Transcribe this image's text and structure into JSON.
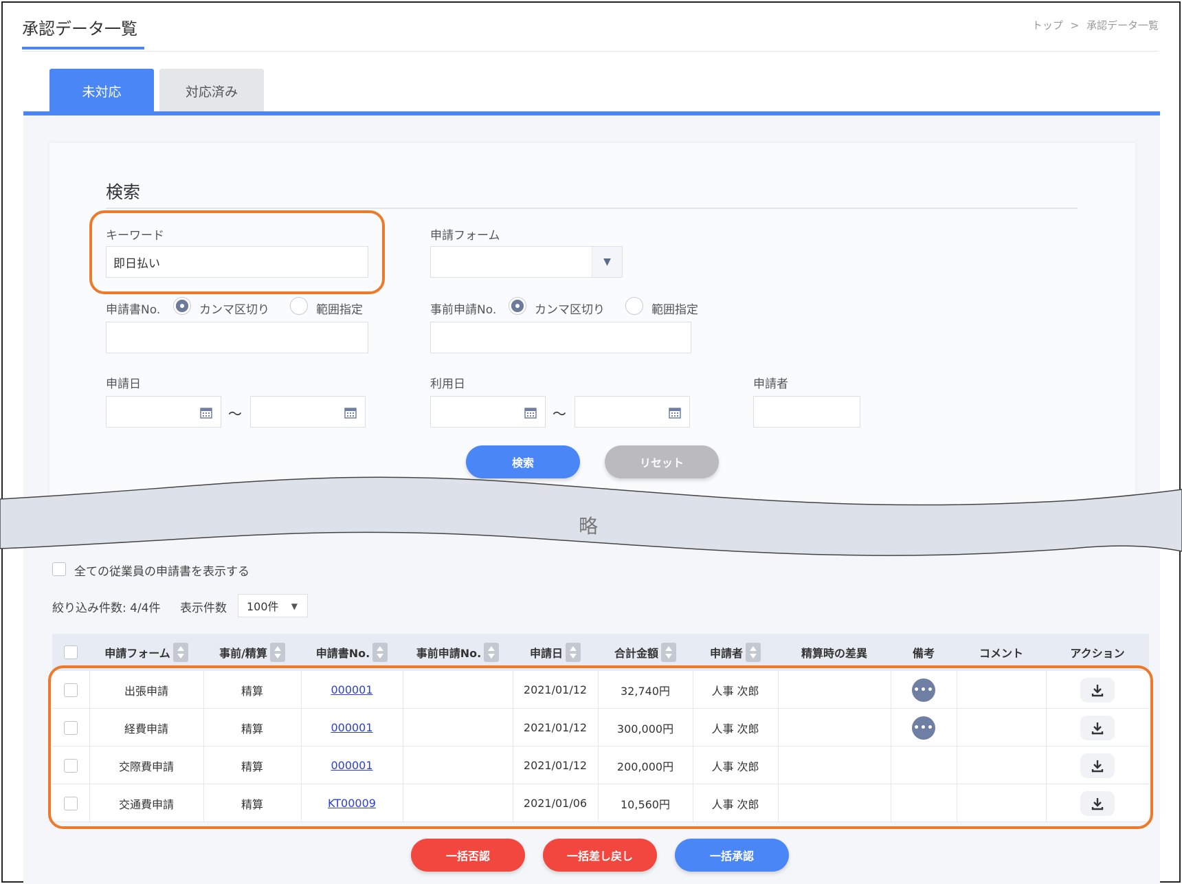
{
  "header": {
    "title": "承認データ一覧",
    "breadcrumb": [
      "トップ",
      ">",
      "承認データ一覧"
    ]
  },
  "tabs": [
    {
      "label": "未対応",
      "active": true
    },
    {
      "label": "対応済み",
      "active": false
    }
  ],
  "search": {
    "title": "検索",
    "keyword_label": "キーワード",
    "keyword_value": "即日払い",
    "form_label": "申請フォーム",
    "form_value": "",
    "app_no_label": "申請書No.",
    "pre_app_no_label": "事前申請No.",
    "radio_comma": "カンマ区切り",
    "radio_range": "範囲指定",
    "app_date_label": "申請日",
    "use_date_label": "利用日",
    "applicant_label": "申請者",
    "tilde": "～",
    "search_button": "検索",
    "reset_button": "リセット"
  },
  "omitted_label": "略",
  "show_all_label": "全ての従業員の申請書を表示する",
  "filter_count": "絞り込み件数: 4/4件",
  "per_page_label": "表示件数",
  "per_page_value": "100件",
  "table": {
    "headers": [
      "申請フォーム",
      "事前/精算",
      "申請書No.",
      "事前申請No.",
      "申請日",
      "合計金額",
      "申請者",
      "精算時の差異",
      "備考",
      "コメント",
      "アクション"
    ],
    "rows": [
      {
        "form": "出張申請",
        "type": "精算",
        "no": "000001",
        "pre_no": "",
        "date": "2021/01/12",
        "amount": "32,740円",
        "applicant": "人事 次郎",
        "has_note": true
      },
      {
        "form": "経費申請",
        "type": "精算",
        "no": "000001",
        "pre_no": "",
        "date": "2021/01/12",
        "amount": "300,000円",
        "applicant": "人事 次郎",
        "has_note": true
      },
      {
        "form": "交際費申請",
        "type": "精算",
        "no": "000001",
        "pre_no": "",
        "date": "2021/01/12",
        "amount": "200,000円",
        "applicant": "人事 次郎",
        "has_note": false
      },
      {
        "form": "交通費申請",
        "type": "精算",
        "no": "KT00009",
        "pre_no": "",
        "date": "2021/01/06",
        "amount": "10,560円",
        "applicant": "人事 次郎",
        "has_note": false
      }
    ]
  },
  "bulk_actions": {
    "reject": "一括否認",
    "return": "一括差し戻し",
    "approve": "一括承認"
  },
  "colors": {
    "accent": "#4a86f5",
    "danger": "#f2473f",
    "highlight": "#ec7a2c"
  }
}
